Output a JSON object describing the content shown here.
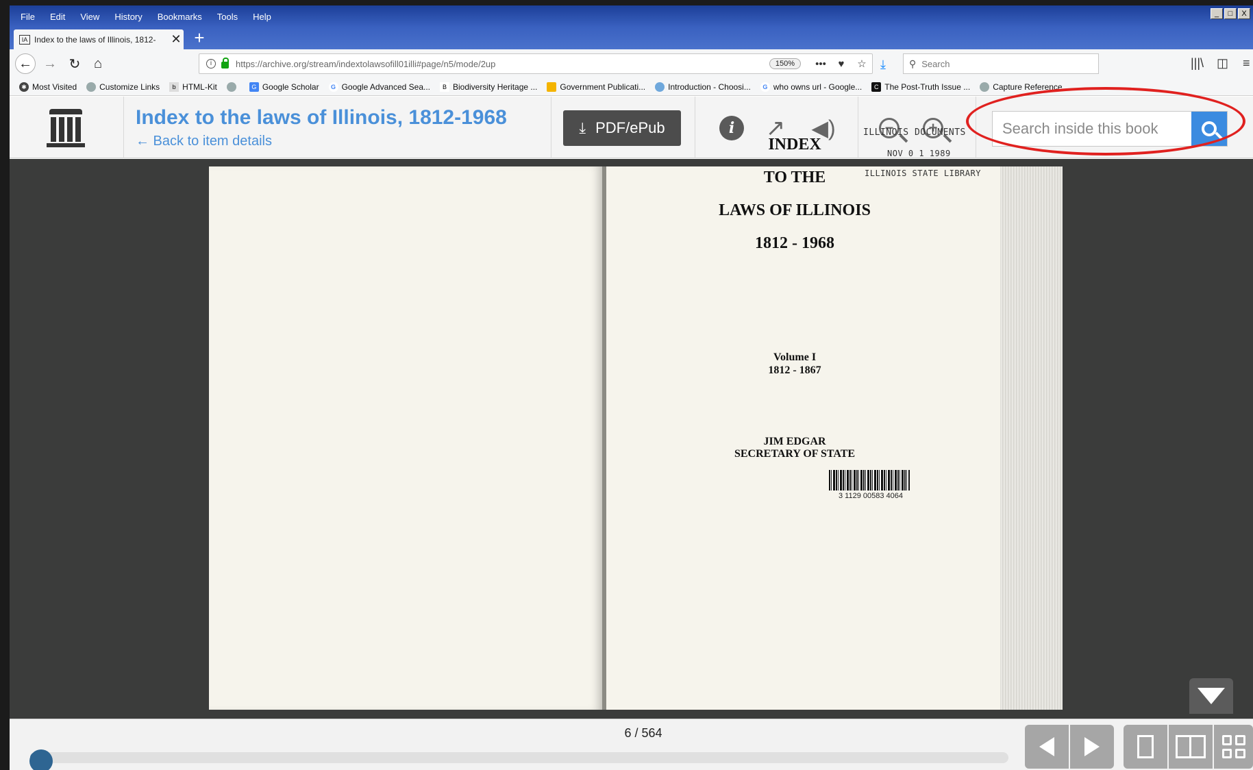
{
  "browser": {
    "menu": [
      "File",
      "Edit",
      "View",
      "History",
      "Bookmarks",
      "Tools",
      "Help"
    ],
    "window_controls": [
      "_",
      "□",
      "X"
    ],
    "tab": {
      "title": "Index to the laws of Illinois, 1812-",
      "favicon": "IA"
    },
    "new_tab_label": "+",
    "url": "https://archive.org/stream/indextolawsofill01illi#page/n5/mode/2up",
    "zoom": "150%",
    "search_placeholder": "Search",
    "bookmarks": [
      "Most Visited",
      "Customize Links",
      "HTML-Kit",
      "",
      "Google Scholar",
      "Google Advanced Sea...",
      "Biodiversity Heritage ...",
      "Government Publicati...",
      "Introduction - Choosi...",
      "who owns url - Google...",
      "The Post-Truth Issue ...",
      "Capture Reference"
    ]
  },
  "reader": {
    "title": "Index to the laws of Illinois, 1812-1968",
    "back_link": "← Back to item details",
    "pdf_button": "PDF/ePub",
    "search_placeholder": "Search inside this book",
    "page_indicator": "6 / 564",
    "progress": 0.0089
  },
  "book_page": {
    "line1": "INDEX",
    "line2": "TO THE",
    "line3": "LAWS OF ILLINOIS",
    "line4": "1812 - 1968",
    "volume": "Volume I",
    "volume_years": "1812 - 1867",
    "author": "JIM EDGAR",
    "author_title": "SECRETARY OF STATE",
    "stamp_line1": "ILLINOIS DOCUMENTS",
    "stamp_line2": "NOV 0 1 1989",
    "stamp_line3": "ILLINOIS STATE LIBRARY",
    "barcode_number": "3 1129 00583 4064"
  },
  "colors": {
    "reader_accent": "#4a90d9",
    "search_button": "#3b8be0",
    "highlight": "#e0211f",
    "viewer_bg": "#3b3c3b"
  }
}
